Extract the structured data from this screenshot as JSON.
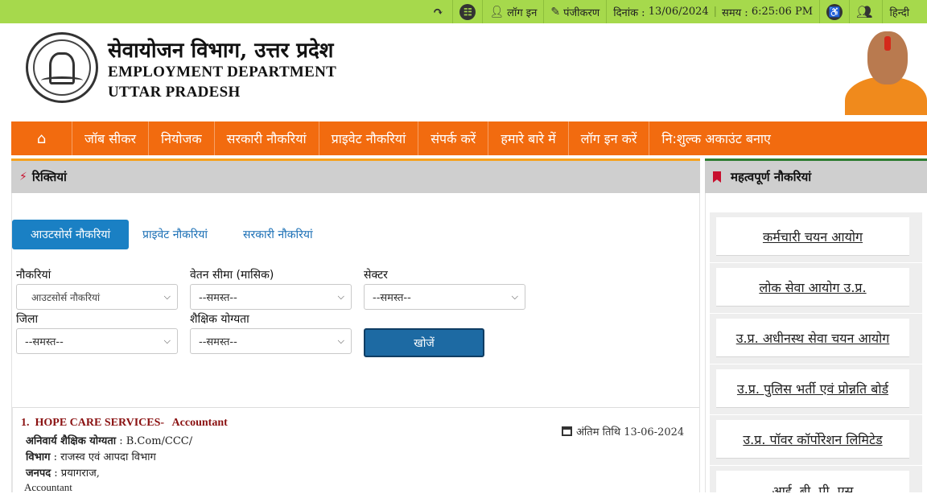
{
  "topbar": {
    "login": "लॉग इन",
    "register": "पंजीकरण",
    "date_label": "दिनांक :",
    "date_value": "13/06/2024",
    "time_label": "समय :",
    "time_value": "6:25:06 PM",
    "language": "हिन्दी"
  },
  "header": {
    "title_hindi": "सेवायोजन विभाग, उत्तर प्रदेश",
    "title_en_line1": "EMPLOYMENT DEPARTMENT",
    "title_en_line2": "UTTAR PRADESH"
  },
  "nav": {
    "items": [
      "जॉब सीकर",
      "नियोजक",
      "सरकारी नौकरियां",
      "प्राइवेट नौकरियां",
      "संपर्क करें",
      "हमारे बारे में",
      "लॉग इन करें",
      "नि:शुल्क अकाउंट बनाए"
    ]
  },
  "vacancies": {
    "heading": "रिक्तियां",
    "tabs": [
      "आउटसोर्स नौकरियां",
      "प्राइवेट नौकरियां",
      "सरकारी नौकरियां"
    ],
    "filters": {
      "jobs_label": "नौकरियां",
      "jobs_value": "आउटसोर्स नौकरियां",
      "salary_label": "वेतन सीमा (मासिक)",
      "salary_value": "--समस्त--",
      "sector_label": "सेक्टर",
      "sector_value": "--समस्त--",
      "district_label": "जिला",
      "district_value": "--समस्त--",
      "qualification_label": "शैक्षिक योग्यता",
      "qualification_value": "--समस्त--"
    },
    "search_button": "खोजें",
    "jobs": [
      {
        "number": "1.",
        "company": "HOPE CARE SERVICES-",
        "role": "Accountant",
        "qualification_label": "अनिवार्य शैक्षिक योग्यता",
        "qualification_value": ": B.Com/CCC/",
        "department_label": "विभाग",
        "department_value": ": राजस्व एवं आपदा विभाग",
        "district_label": "जनपद",
        "district_value": ": प्रयागराज,",
        "role_line": "Accountant",
        "deadline": "अंतिम तिथि 13-06-2024"
      }
    ]
  },
  "important_jobs": {
    "heading": "महत्वपूर्ण नौकरियां",
    "links": [
      "कर्मचारी चयन आयोग",
      "लोक सेवा आयोग उ.प्र.",
      "उ.प्र. अधीनस्थ सेवा चयन आयोग",
      "उ.प्र. पुलिस भर्ती एवं प्रोन्नति बोर्ड",
      "उ.प्र. पॉवर कॉर्पोरेशन लिमिटेड",
      "आई. बी. पी. एस"
    ]
  },
  "colors": {
    "topbar": "#a6d94c",
    "nav": "#f26b0f",
    "tab_active": "#1a80c4",
    "search_button": "#1d6aa3",
    "job_title": "#8a1111"
  }
}
